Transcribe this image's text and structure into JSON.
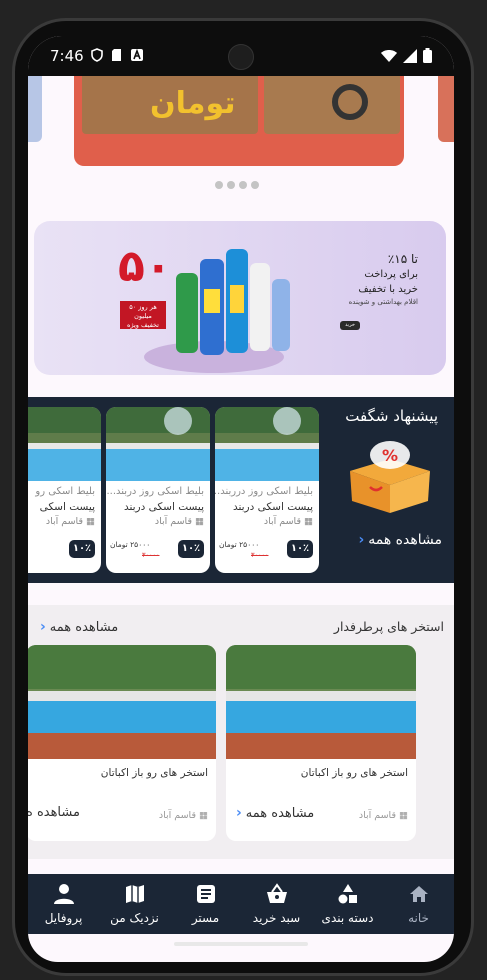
{
  "status_bar": {
    "time": "7:46"
  },
  "top_banner": {
    "text": "تومان"
  },
  "promo_banner": {
    "big_number": "۵۰",
    "tag_line1": "هر روز ۵۰ میلیون",
    "tag_line2": "تخفیف ویژه",
    "pct": "تا ۱۵٪",
    "line1": "برای پرداخت",
    "line2": "خرید با تخفیف",
    "small": "اقلام بهداشتی و شوینده",
    "button": "خرید"
  },
  "special_offer": {
    "title": "پیشنهاد شگفت",
    "see_all": "مشاهده همه",
    "cards": [
      {
        "subtitle": "بلیط اسکی روز درربند...",
        "title": "پیست اسکی دربند",
        "location": "قاسم آباد",
        "price": "۲۵۰۰۰ تومان",
        "old_price": "۳۰۰۰۰",
        "badge": "۱۰٪"
      },
      {
        "subtitle": "بلیط اسکی روز دربند...",
        "title": "پیست اسکی دربند",
        "location": "قاسم آباد",
        "price": "۲۵۰۰۰ تومان",
        "old_price": "۳۰۰۰۰",
        "badge": "۱۰٪"
      },
      {
        "subtitle": "بلیط اسکی رو",
        "title": "پیست اسکی",
        "location": "قاسم آباد",
        "price": "...",
        "old_price": "",
        "badge": "۱۰٪"
      }
    ]
  },
  "popular_pools": {
    "title": "استخر های پرطرفدار",
    "see_all": "مشاهده همه",
    "cards": [
      {
        "name": "استخر های رو باز اکباتان",
        "location": "قاسم آباد",
        "see_all": "مشاهده همه"
      },
      {
        "name": "استخر های رو باز اکباتان",
        "location": "قاسم آباد",
        "see_all": "مشاهده ه"
      }
    ]
  },
  "bottom_nav": {
    "items": [
      {
        "label": "خانه",
        "icon": "home-icon",
        "active": true
      },
      {
        "label": "دسته بندی",
        "icon": "category-icon",
        "active": false
      },
      {
        "label": "سبد خرید",
        "icon": "basket-icon",
        "active": false
      },
      {
        "label": "مستر",
        "icon": "list-icon",
        "active": false
      },
      {
        "label": "نزدیک من",
        "icon": "map-icon",
        "active": false
      },
      {
        "label": "پروفایل",
        "icon": "person-icon",
        "active": false
      }
    ]
  },
  "colors": {
    "nav_bg": "#1b2636",
    "accent": "#4a8cf5",
    "sale_red": "#d33333"
  }
}
